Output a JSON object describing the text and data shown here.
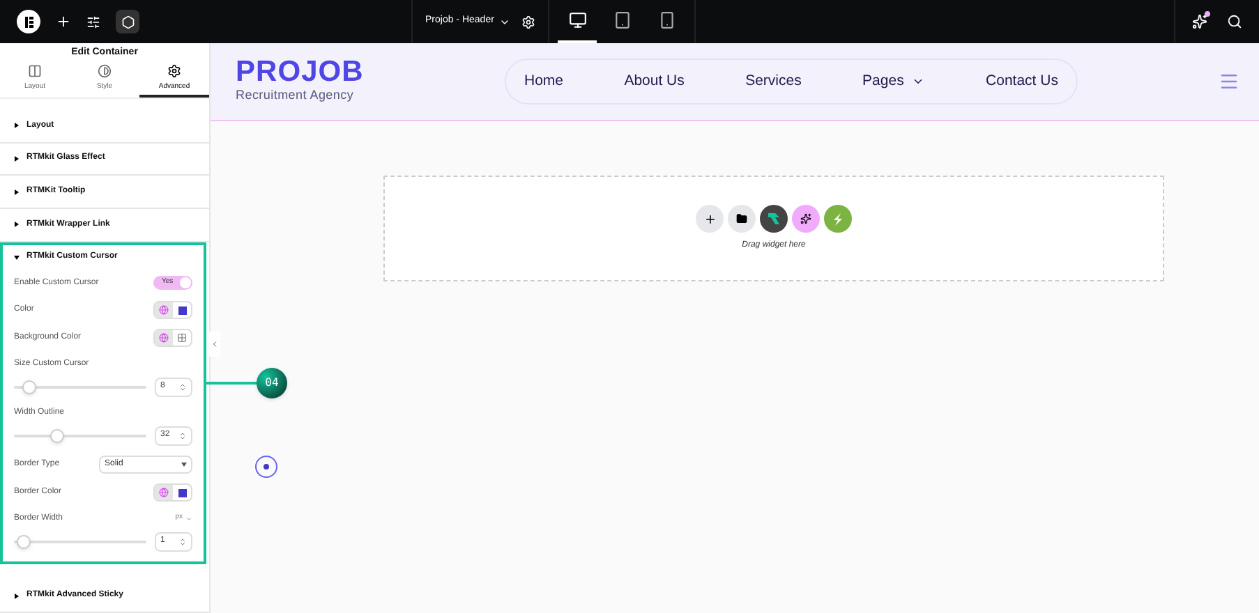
{
  "topbar": {
    "document_title": "Projob - Header",
    "devices": [
      {
        "kind": "desktop",
        "selected": true
      },
      {
        "kind": "tablet",
        "selected": false
      },
      {
        "kind": "mobile",
        "selected": false
      }
    ]
  },
  "panel": {
    "title": "Edit Container",
    "tabs": [
      {
        "label": "Layout",
        "kind": "layout",
        "selected": false
      },
      {
        "label": "Style",
        "kind": "style",
        "selected": false
      },
      {
        "label": "Advanced",
        "kind": "advanced",
        "selected": true
      }
    ],
    "sections_before": [
      {
        "title": "Layout",
        "expanded": false
      },
      {
        "title": "RTMkit Glass Effect",
        "expanded": false
      },
      {
        "title": "RTMKit Tooltip",
        "expanded": false
      },
      {
        "title": "RTMkit Wrapper Link",
        "expanded": false
      }
    ],
    "open_section": {
      "title": "RTMkit Custom Cursor",
      "expanded": true,
      "controls": [
        {
          "kind": "toggle",
          "label": "Enable Custom Cursor",
          "value": "Yes",
          "on": true
        },
        {
          "kind": "color",
          "label": "Color",
          "color": "#4338ca"
        },
        {
          "kind": "color",
          "label": "Background Color"
        },
        {
          "kind": "slider",
          "label": "Size Custom Cursor",
          "value": "8",
          "level": 0.05
        },
        {
          "kind": "slider",
          "label": "Width Outline",
          "value": "32",
          "level": 0.3
        },
        {
          "kind": "select",
          "label": "Border Type",
          "value": "Solid"
        },
        {
          "kind": "color",
          "label": "Border Color",
          "color": "#4338ca"
        },
        {
          "kind": "slider",
          "label": "Border Width",
          "unit": "px",
          "value": "1",
          "level": 0
        }
      ]
    },
    "sections_after": [
      {
        "title": "RTMkit Advanced Sticky",
        "expanded": false
      }
    ]
  },
  "site": {
    "logo": "PROJOB",
    "tagline": "Recruitment Agency",
    "nav": [
      {
        "label": "Home"
      },
      {
        "label": "About Us"
      },
      {
        "label": "Services"
      },
      {
        "label": "Pages",
        "dropdown": true
      },
      {
        "label": "Contact Us"
      }
    ]
  },
  "drop_zone": {
    "hint": "Drag widget here"
  },
  "callout": {
    "number": "04"
  }
}
